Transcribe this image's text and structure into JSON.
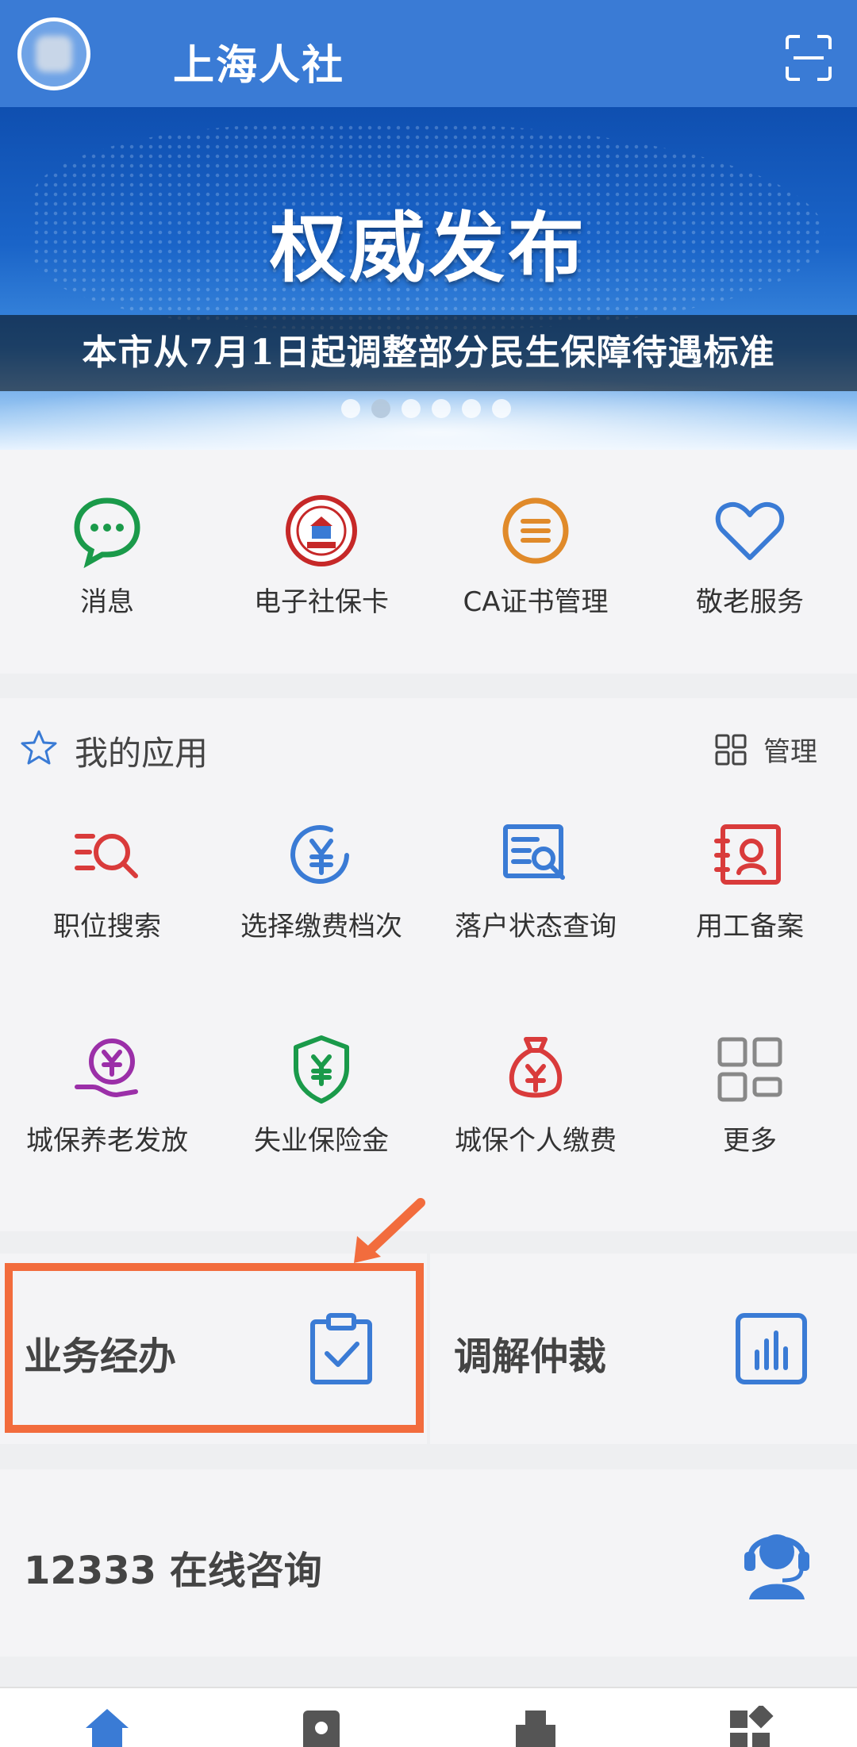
{
  "header": {
    "title": "上海人社",
    "avatar_icon": "user-avatar-icon",
    "scan_icon": "scan-icon"
  },
  "banner": {
    "heading": "权威发布",
    "subtitle": "本市从7月1日起调整部分民生保障待遇标准",
    "slide_count": 6,
    "active_slide": 2
  },
  "quick_services": [
    {
      "label": "消息",
      "icon": "message-icon",
      "color": "#1a9a4a"
    },
    {
      "label": "电子社保卡",
      "icon": "social-security-card-icon",
      "color": "#c62828"
    },
    {
      "label": "CA证书管理",
      "icon": "ca-certificate-icon",
      "color": "#e08a2a"
    },
    {
      "label": "敬老服务",
      "icon": "heart-icon",
      "color": "#3a7bd5"
    }
  ],
  "my_apps": {
    "title": "我的应用",
    "manage_label": "管理",
    "items": [
      {
        "label": "职位搜索",
        "icon": "job-search-icon",
        "color": "#d93b3b"
      },
      {
        "label": "选择缴费档次",
        "icon": "yuan-circle-icon",
        "color": "#3a7bd5"
      },
      {
        "label": "落户状态查询",
        "icon": "document-search-icon",
        "color": "#3a7bd5"
      },
      {
        "label": "用工备案",
        "icon": "employment-record-icon",
        "color": "#d93b3b"
      },
      {
        "label": "城保养老发放",
        "icon": "pension-hand-icon",
        "color": "#9b2fa8"
      },
      {
        "label": "失业保险金",
        "icon": "shield-yuan-icon",
        "color": "#1a9a4a"
      },
      {
        "label": "城保个人缴费",
        "icon": "money-bag-icon",
        "color": "#d93b3b"
      },
      {
        "label": "更多",
        "icon": "grid-more-icon",
        "color": "#888888"
      }
    ]
  },
  "tiles": [
    {
      "label": "业务经办",
      "icon": "clipboard-check-icon"
    },
    {
      "label": "调解仲裁",
      "icon": "bar-chart-icon"
    }
  ],
  "consult": {
    "label": "12333 在线咨询",
    "icon": "headset-agent-icon"
  },
  "bottom_nav": [
    {
      "icon": "home-icon",
      "color": "#3a7bd5"
    },
    {
      "icon": "profile-card-icon",
      "color": "#555555"
    },
    {
      "icon": "building-icon",
      "color": "#555555"
    },
    {
      "icon": "apps-icon",
      "color": "#555555"
    }
  ],
  "colors": {
    "primary": "#3a7bd5",
    "highlight": "#f26c3d"
  }
}
